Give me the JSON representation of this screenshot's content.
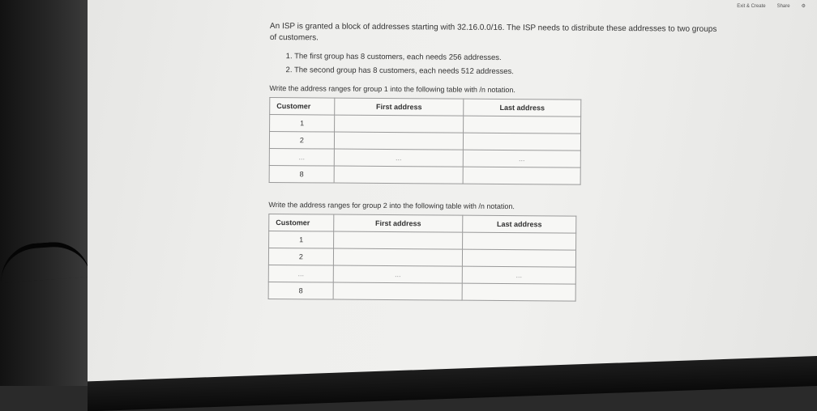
{
  "topbar": {
    "items": [
      "Exit & Create",
      "Share",
      "⚙"
    ]
  },
  "question": {
    "text": "An ISP is granted a block of addresses starting with 32.16.0.0/16. The ISP needs to distribute these addresses to two groups of customers.",
    "items": [
      "1. The first group has 8 customers, each needs 256 addresses.",
      "2. The second group has 8 customers, each needs 512 addresses."
    ]
  },
  "group1": {
    "instruction": "Write the address ranges for group 1 into the following table with /n notation.",
    "headers": [
      "Customer",
      "First address",
      "Last address"
    ],
    "rows": [
      {
        "customer": "1",
        "first": "",
        "last": ""
      },
      {
        "customer": "2",
        "first": "",
        "last": ""
      },
      {
        "customer": "...",
        "first": "...",
        "last": "..."
      },
      {
        "customer": "8",
        "first": "",
        "last": ""
      }
    ]
  },
  "group2": {
    "instruction": "Write the address ranges for group 2 into the following table with /n notation.",
    "headers": [
      "Customer",
      "First address",
      "Last address"
    ],
    "rows": [
      {
        "customer": "1",
        "first": "",
        "last": ""
      },
      {
        "customer": "2",
        "first": "",
        "last": ""
      },
      {
        "customer": "...",
        "first": "...",
        "last": "..."
      },
      {
        "customer": "8",
        "first": "",
        "last": ""
      }
    ]
  }
}
